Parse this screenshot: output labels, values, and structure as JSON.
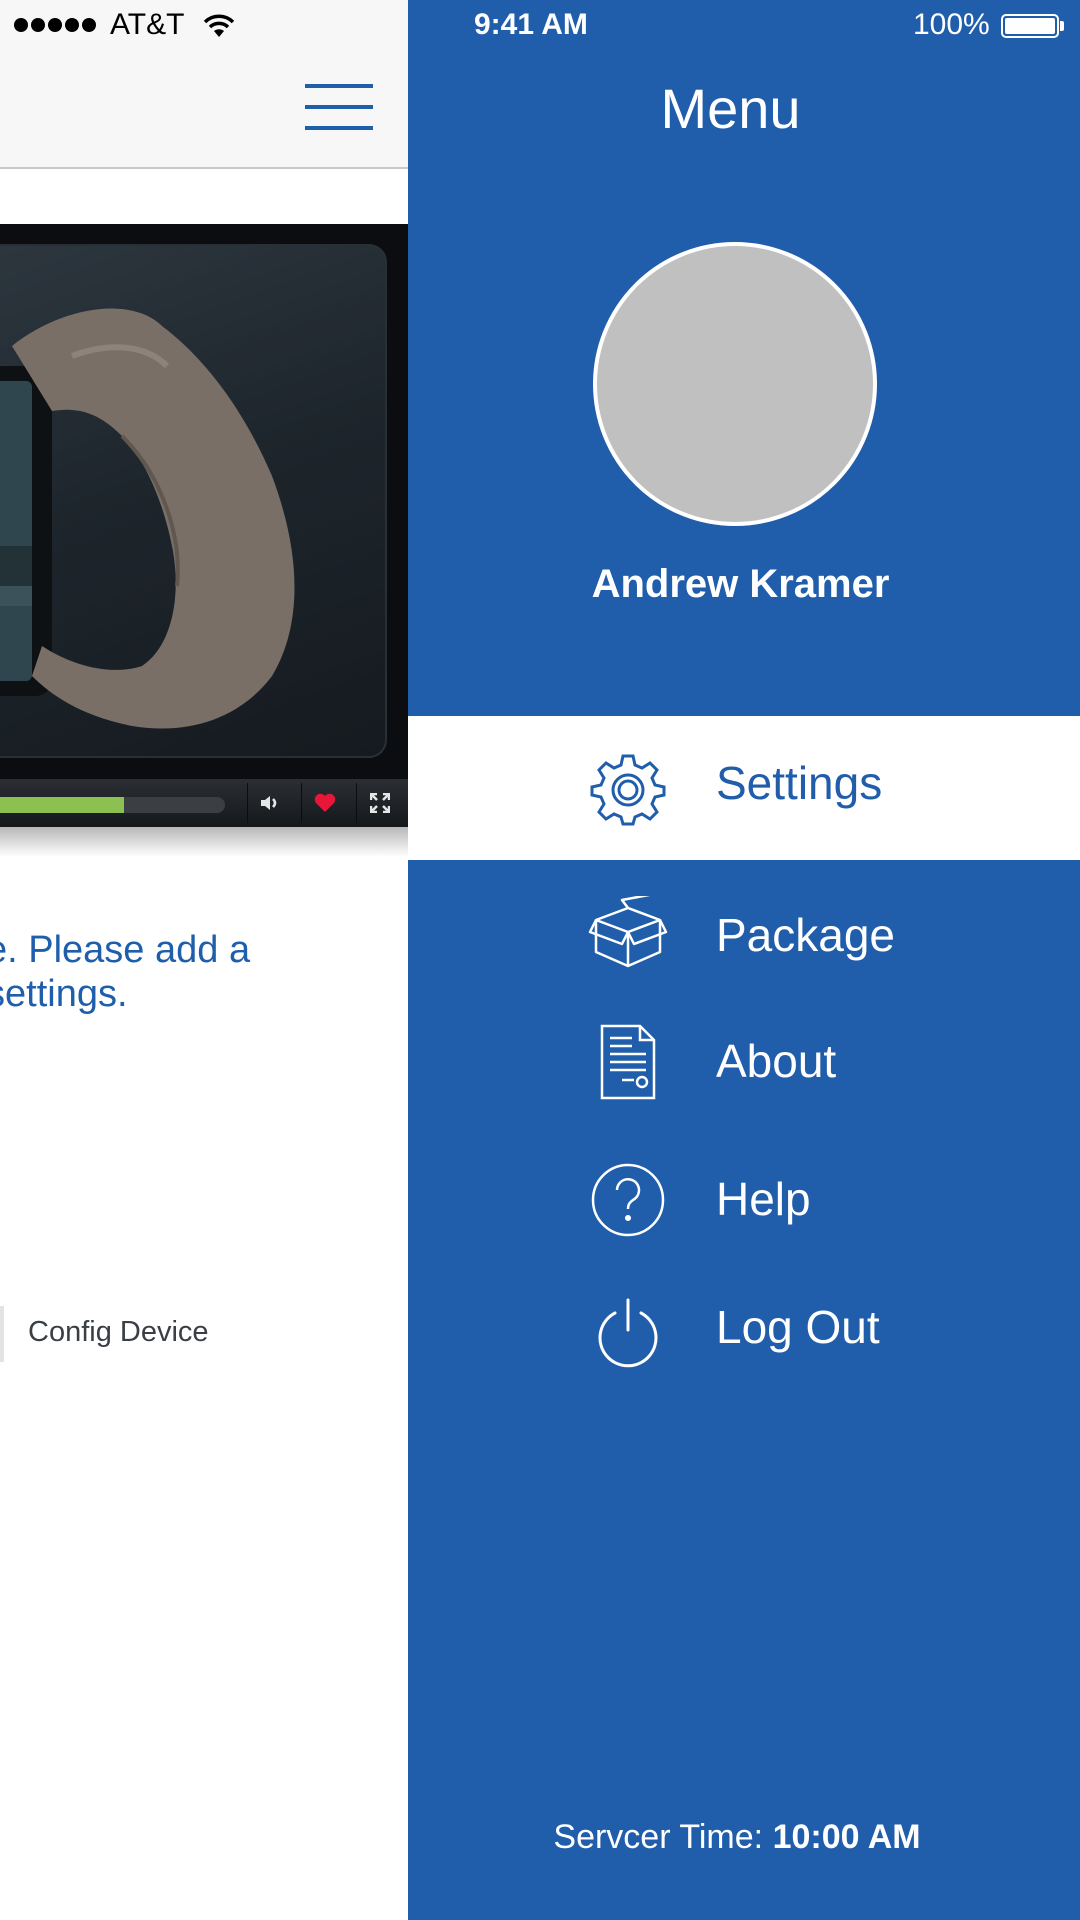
{
  "status_bar": {
    "carrier": "AT&T",
    "time": "9:41 AM",
    "battery": "100%"
  },
  "background_screen": {
    "video_player": {
      "progress": 0.55
    },
    "message_line1": "e. Please add a",
    "message_line2": "settings.",
    "config_device_label": "Config Device"
  },
  "menu": {
    "title": "Menu",
    "user_name": "Andrew Kramer",
    "items": [
      {
        "label": "Settings",
        "icon": "gear-icon",
        "active": true
      },
      {
        "label": "Package",
        "icon": "box-icon",
        "active": false
      },
      {
        "label": "About",
        "icon": "document-icon",
        "active": false
      },
      {
        "label": "Help",
        "icon": "question-icon",
        "active": false
      },
      {
        "label": "Log Out",
        "icon": "power-icon",
        "active": false
      }
    ],
    "server_time_label": "Servcer Time:",
    "server_time_value": "10:00 AM"
  },
  "colors": {
    "brand_blue": "#205eab",
    "progress_green": "#8cc152",
    "heart_red": "#e8173a"
  }
}
